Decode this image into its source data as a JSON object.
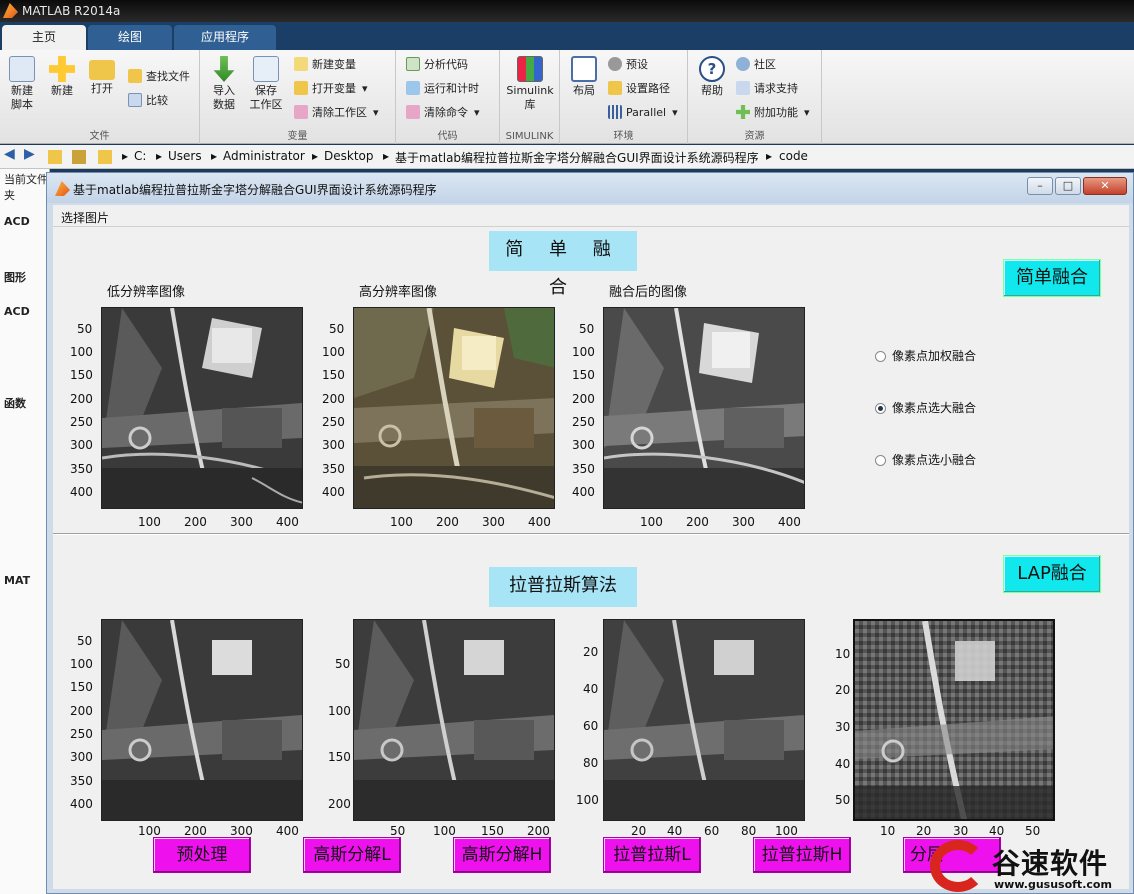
{
  "app_title": "MATLAB R2014a",
  "tabs": [
    {
      "label": "主页"
    },
    {
      "label": "绘图"
    },
    {
      "label": "应用程序"
    }
  ],
  "ribbon": {
    "file": {
      "label": "文件",
      "new_script": "新建\n脚本",
      "new": "新建",
      "open": "打开",
      "find_files": "查找文件",
      "compare": "比较"
    },
    "variable": {
      "label": "变量",
      "import": "导入\n数据",
      "save_ws": "保存\n工作区",
      "new_var": "新建变量",
      "open_var": "打开变量",
      "clear_ws": "清除工作区"
    },
    "code": {
      "label": "代码",
      "analyze": "分析代码",
      "run_time": "运行和计时",
      "clear_cmd": "清除命令"
    },
    "simulink": {
      "label": "SIMULINK",
      "lib": "Simulink\n库"
    },
    "env": {
      "label": "环境",
      "layout": "布局",
      "prefs": "预设",
      "set_path": "设置路径",
      "parallel": "Parallel"
    },
    "resources": {
      "label": "资源",
      "help": "帮助",
      "community": "社区",
      "support": "请求支持",
      "addons": "附加功能"
    }
  },
  "address": [
    "C:",
    "Users",
    "Administrator",
    "Desktop",
    "基于matlab编程拉普拉斯金字塔分解融合GUI界面设计系统源码程序",
    "code"
  ],
  "left_panel": {
    "title": "当前文件夹",
    "items": [
      "ACD",
      "图形",
      "ACD",
      "函数",
      "MAT"
    ]
  },
  "gui": {
    "window_title": "基于matlab编程拉普拉斯金字塔分解融合GUI界面设计系统源码程序",
    "menu": "选择图片",
    "simple_section": {
      "title": "简 单 融 合",
      "button": "简单融合",
      "axes": [
        {
          "title": "低分辨率图像"
        },
        {
          "title": "高分辨率图像"
        },
        {
          "title": "融合后的图像"
        }
      ],
      "yticks": [
        "50",
        "100",
        "150",
        "200",
        "250",
        "300",
        "350",
        "400"
      ],
      "xticks": [
        "100",
        "200",
        "300",
        "400"
      ],
      "radios": [
        {
          "label": "像素点加权融合",
          "selected": false
        },
        {
          "label": "像素点选大融合",
          "selected": true
        },
        {
          "label": "像素点选小融合",
          "selected": false
        }
      ]
    },
    "lap_section": {
      "title": "拉普拉斯算法",
      "button": "LAP融合",
      "ax1_yticks": [
        "50",
        "100",
        "150",
        "200",
        "250",
        "300",
        "350",
        "400"
      ],
      "ax1_xticks": [
        "100",
        "200",
        "300",
        "400"
      ],
      "ax2_yticks": [
        "50",
        "100",
        "150",
        "200"
      ],
      "ax2_xticks": [
        "50",
        "100",
        "150",
        "200"
      ],
      "ax3_yticks": [
        "20",
        "40",
        "60",
        "80",
        "100"
      ],
      "ax3_xticks": [
        "20",
        "40",
        "60",
        "80",
        "100"
      ],
      "ax4_yticks": [
        "10",
        "20",
        "30",
        "40",
        "50"
      ],
      "ax4_xticks": [
        "10",
        "20",
        "30",
        "40",
        "50"
      ],
      "buttons": [
        "预处理",
        "高斯分解L",
        "高斯分解H",
        "拉普拉斯L",
        "拉普拉斯H",
        "分层"
      ]
    }
  },
  "watermark": {
    "text": "谷速软件",
    "url": "www.gususoft.com"
  },
  "colors": {
    "button_cyan": "#11e8ee",
    "button_magenta": "#ee11ee",
    "label_cyan": "#a6e4f6"
  }
}
